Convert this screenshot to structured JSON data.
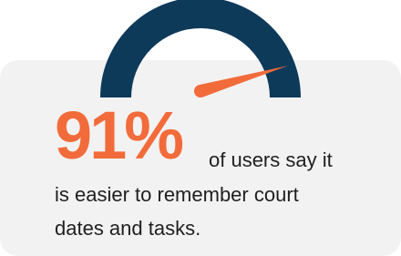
{
  "stat": {
    "percent_label": "91%",
    "gauge_value": 0.91,
    "text_line1": "of users say it",
    "text_line2": "is easier to remember court",
    "text_line3": "dates and tasks."
  },
  "colors": {
    "gauge_arc": "#0e3a5a",
    "needle": "#f26b3a",
    "accent": "#f26b3a",
    "card_background": "#f2f2f2",
    "text": "#1f1f1f"
  }
}
